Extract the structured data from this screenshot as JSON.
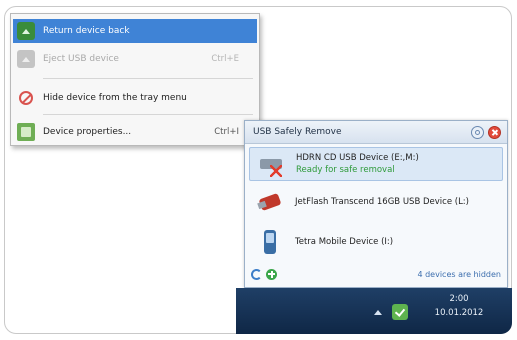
{
  "context_menu": {
    "items": [
      {
        "label": "Return device back",
        "shortcut": "",
        "icon": "eject-icon",
        "state": "highlighted"
      },
      {
        "label": "Eject USB device",
        "shortcut": "Ctrl+E",
        "icon": "eject-icon",
        "state": "disabled"
      },
      {
        "label": "Hide device from the tray menu",
        "shortcut": "",
        "icon": "hide-icon",
        "state": "normal"
      },
      {
        "label": "Device properties...",
        "shortcut": "Ctrl+I",
        "icon": "properties-icon",
        "state": "normal"
      }
    ]
  },
  "popup": {
    "title": "USB Safely Remove",
    "devices": [
      {
        "name": "HDRN CD USB Device (E:,M:)",
        "status": "Ready for safe removal",
        "icon": "dvd-drive-icon",
        "selected": true
      },
      {
        "name": "JetFlash Transcend 16GB USB Device (L:)",
        "status": "",
        "icon": "flash-drive-icon",
        "selected": false
      },
      {
        "name": "Tetra Mobile Device (I:)",
        "status": "",
        "icon": "mobile-phone-icon",
        "selected": false
      }
    ],
    "footer": {
      "hidden_devices_text": "4 devices are hidden"
    }
  },
  "taskbar": {
    "time": "2:00",
    "date": "10.01.2012"
  },
  "colors": {
    "menu_highlight": "#3f83d6",
    "status_green": "#2e9a3a",
    "taskbar": "#1a3558"
  }
}
